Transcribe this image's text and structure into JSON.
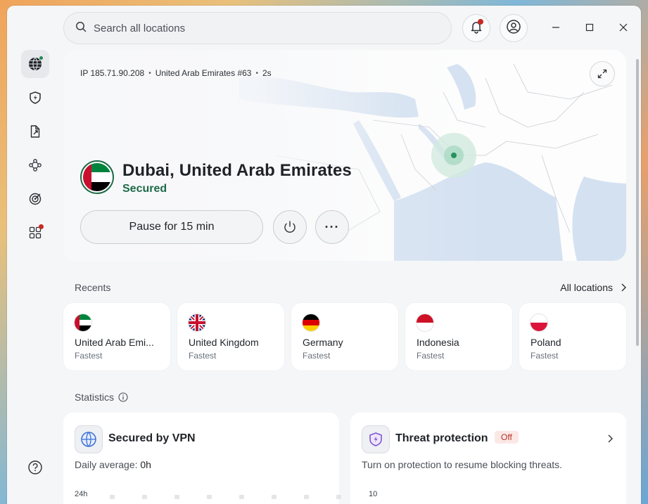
{
  "search": {
    "placeholder": "Search all locations"
  },
  "window": {
    "minimize": "—",
    "maximize": "□",
    "close": "×"
  },
  "connection": {
    "ip": "IP 185.71.90.208",
    "server": "United Arab Emirates #63",
    "duration": "2s",
    "city": "Dubai, United Arab Emirates",
    "status": "Secured",
    "pause_label": "Pause for 15 min",
    "more_label": "···"
  },
  "recents": {
    "title": "Recents",
    "all_locations": "All locations",
    "items": [
      {
        "name": "United Arab Emi...",
        "sub": "Fastest",
        "flag": "uae"
      },
      {
        "name": "United Kingdom",
        "sub": "Fastest",
        "flag": "uk"
      },
      {
        "name": "Germany",
        "sub": "Fastest",
        "flag": "germany"
      },
      {
        "name": "Indonesia",
        "sub": "Fastest",
        "flag": "indonesia"
      },
      {
        "name": "Poland",
        "sub": "Fastest",
        "flag": "poland"
      }
    ]
  },
  "statistics": {
    "title": "Statistics",
    "vpn": {
      "title": "Secured by VPN",
      "desc_label": "Daily average: ",
      "desc_value": "0h",
      "axis_top": "24h"
    },
    "threat": {
      "title": "Threat protection",
      "badge": "Off",
      "desc": "Turn on protection to resume blocking threats.",
      "axis_top": "10"
    }
  },
  "colors": {
    "secured_green": "#1e6a48",
    "badge_red": "#b3322a",
    "notification_dot": "#c62b22"
  }
}
